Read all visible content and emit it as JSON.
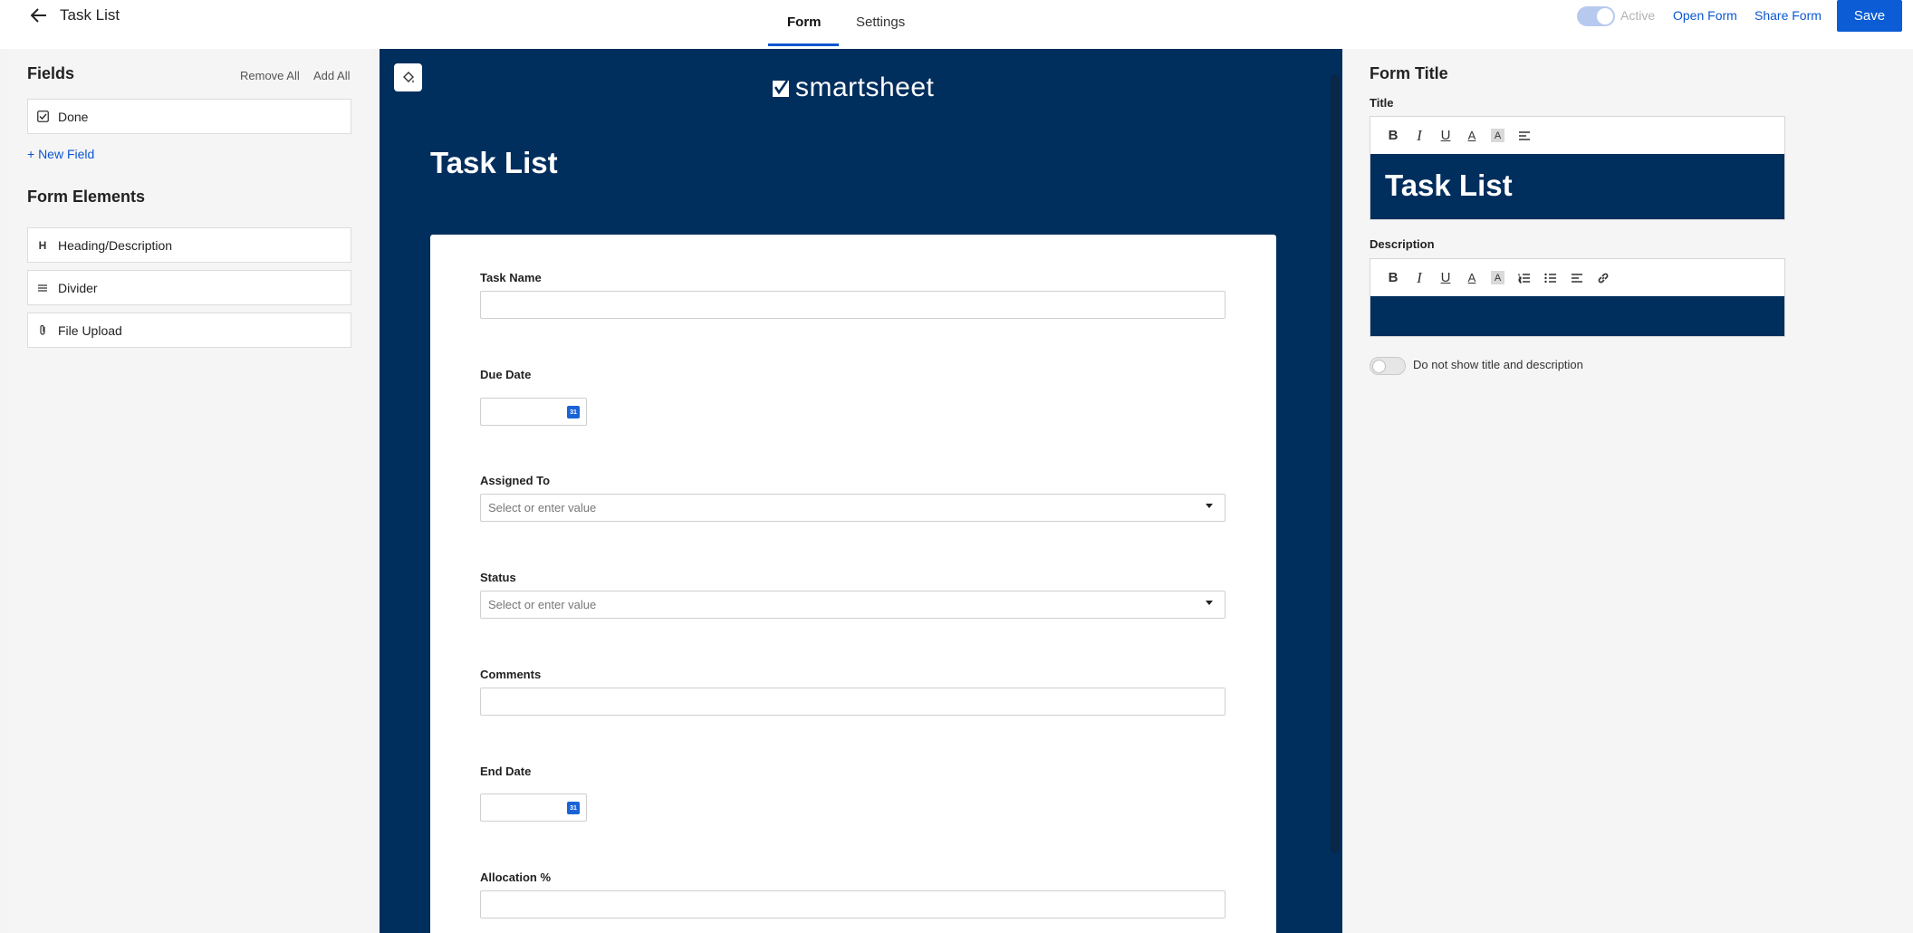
{
  "header": {
    "back_icon": "arrow-left-icon",
    "title": "Task List",
    "tabs": [
      {
        "label": "Form",
        "selected": true
      },
      {
        "label": "Settings",
        "selected": false
      }
    ],
    "active_label": "Active",
    "open_form": "Open Form",
    "share_form": "Share Form",
    "save": "Save",
    "accent": "#0b57d0"
  },
  "left": {
    "fields_title": "Fields",
    "remove_all": "Remove All",
    "add_all": "Add All",
    "fields": [
      {
        "label": "Done",
        "icon": "checkbox-icon"
      }
    ],
    "new_field": "+ New Field",
    "elements_title": "Form Elements",
    "elements": [
      {
        "label": "Heading/Description",
        "icon": "heading-icon",
        "glyph": "H"
      },
      {
        "label": "Divider",
        "icon": "divider-icon"
      },
      {
        "label": "File Upload",
        "icon": "paperclip-icon"
      }
    ]
  },
  "canvas": {
    "logo": "smartsheet",
    "heading": "Task List",
    "background": "#002e5d",
    "fields": [
      {
        "label": "Task Name",
        "type": "text"
      },
      {
        "label": "Due Date",
        "type": "date",
        "icon": "calendar-icon"
      },
      {
        "label": "Assigned To",
        "type": "select",
        "placeholder": "Select or enter value"
      },
      {
        "label": "Status",
        "type": "select",
        "placeholder": "Select or enter value"
      },
      {
        "label": "Comments",
        "type": "text"
      },
      {
        "label": "End Date",
        "type": "date",
        "icon": "calendar-icon"
      },
      {
        "label": "Allocation %",
        "type": "text"
      }
    ]
  },
  "right": {
    "title": "Form Title",
    "title_label": "Title",
    "title_value": "Task List",
    "description_label": "Description",
    "description_value": "",
    "hide_label": "Do not show title and description"
  }
}
